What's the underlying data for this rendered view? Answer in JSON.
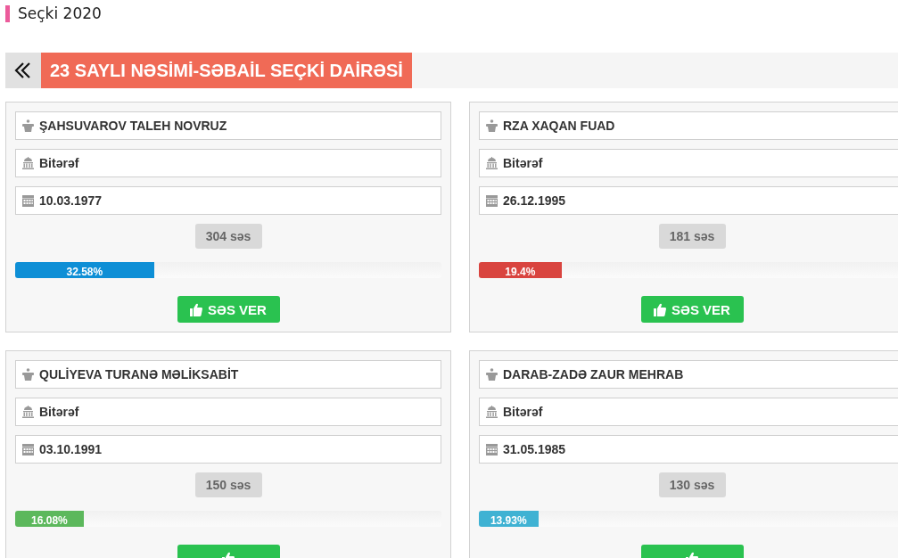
{
  "page_title": "Seçki 2020",
  "district": {
    "title": "23 SAYLI NƏSİMİ-SƏBAİL SEÇKİ DAİRƏSİ"
  },
  "candidates": [
    {
      "name": "ŞAHSUVAROV TALEH NOVRUZ",
      "party": "Bitərəf",
      "birth_date": "10.03.1977",
      "votes": "304 səs",
      "level": 0.3258,
      "percent": "32.58%",
      "color": "#0e8fd6",
      "button": "SƏS VER"
    },
    {
      "name": "RZA XAQAN FUAD",
      "party": "Bitərəf",
      "birth_date": "26.12.1995",
      "votes": "181 səs",
      "level": 0.194,
      "percent": "19.4%",
      "color": "#d9443f",
      "button": "SƏS VER"
    },
    {
      "name": "QULİYEVA TURANƏ MƏLİKSABİT",
      "party": "Bitərəf",
      "birth_date": "03.10.1991",
      "votes": "150 səs",
      "level": 0.1608,
      "percent": "16.08%",
      "color": "#5cb85c"
    },
    {
      "name": "DARAB-ZADƏ ZAUR MEHRAB",
      "party": "Bitərəf",
      "birth_date": "31.05.1985",
      "votes": "130 səs",
      "level": 0.1393,
      "percent": "13.93%",
      "color": "#3fb2d3"
    }
  ]
}
